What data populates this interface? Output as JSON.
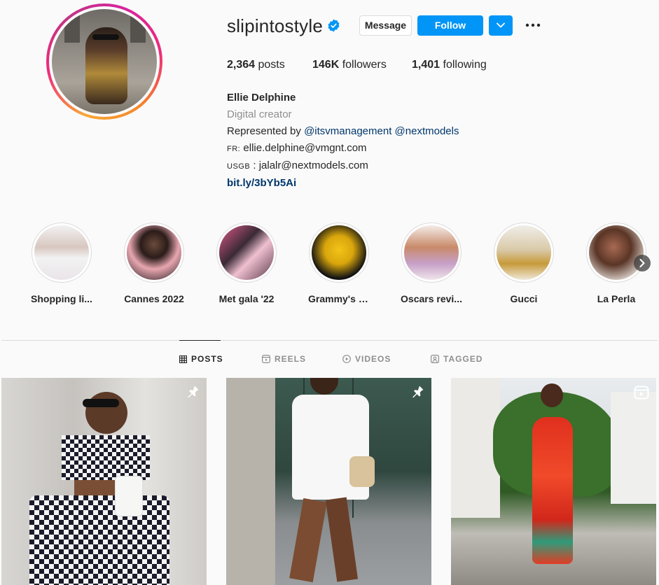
{
  "profile": {
    "username": "slipintostyle",
    "verified": true,
    "message_label": "Message",
    "follow_label": "Follow",
    "stats": {
      "posts_count": "2,364",
      "posts_label": "posts",
      "followers_count": "146K",
      "followers_label": "followers",
      "following_count": "1,401",
      "following_label": "following"
    },
    "bio": {
      "name": "Ellie Delphine",
      "category": "Digital creator",
      "represented_prefix": "Represented by",
      "mention_1": "@itsvmanagement",
      "mention_2": "@nextmodels",
      "fr_tag": "FR:",
      "fr_email": "ellie.delphine@vmgnt.com",
      "usgb_tag": "USGB",
      "usgb_email": ": jalalr@nextmodels.com",
      "url": "bit.ly/3bYb5Ai"
    }
  },
  "highlights": [
    {
      "label": "Shopping li..."
    },
    {
      "label": "Cannes 2022"
    },
    {
      "label": "Met gala '22"
    },
    {
      "label": "Grammy's r..."
    },
    {
      "label": "Oscars revi..."
    },
    {
      "label": "Gucci"
    },
    {
      "label": "La Perla"
    }
  ],
  "tabs": [
    {
      "label": "POSTS",
      "icon": "grid-icon",
      "active": true
    },
    {
      "label": "REELS",
      "icon": "reels-icon",
      "active": false
    },
    {
      "label": "VIDEOS",
      "icon": "play-icon",
      "active": false
    },
    {
      "label": "TAGGED",
      "icon": "tag-icon",
      "active": false
    }
  ],
  "posts": [
    {
      "badge": "pin-icon"
    },
    {
      "badge": "pin-icon"
    },
    {
      "badge": "reel-icon"
    }
  ],
  "colors": {
    "accent": "#0095f6",
    "link": "#00376b",
    "muted": "#8e8e8e",
    "text": "#262626"
  }
}
